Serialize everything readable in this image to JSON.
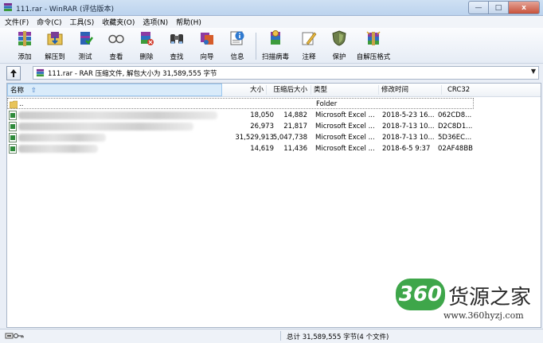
{
  "window": {
    "title": "111.rar - WinRAR (评估版本)",
    "min_label": "—",
    "max_label": "□",
    "close_label": "x"
  },
  "menu": [
    "文件(F)",
    "命令(C)",
    "工具(S)",
    "收藏夹(O)",
    "选项(N)",
    "帮助(H)"
  ],
  "toolbar": [
    {
      "label": "添加",
      "icon": "add-books-icon"
    },
    {
      "label": "解压到",
      "icon": "extract-folder-icon"
    },
    {
      "label": "测试",
      "icon": "test-icon"
    },
    {
      "label": "查看",
      "icon": "view-glasses-icon"
    },
    {
      "label": "删除",
      "icon": "delete-icon"
    },
    {
      "label": "查找",
      "icon": "find-binoculars-icon"
    },
    {
      "label": "向导",
      "icon": "wizard-icon"
    },
    {
      "label": "信息",
      "icon": "info-icon"
    },
    {
      "label": "扫描病毒",
      "icon": "virus-scan-icon"
    },
    {
      "label": "注释",
      "icon": "comment-icon"
    },
    {
      "label": "保护",
      "icon": "protect-shield-icon"
    },
    {
      "label": "自解压格式",
      "icon": "sfx-icon"
    }
  ],
  "address": {
    "text": "111.rar - RAR 压缩文件, 解包大小为 31,589,555 字节"
  },
  "columns": {
    "name": "名称",
    "size": "大小",
    "packed": "压缩后大小",
    "type": "类型",
    "modified": "修改时间",
    "crc": "CRC32"
  },
  "rows": [
    {
      "name": "..",
      "size": "",
      "packed": "",
      "type": "Folder",
      "modified": "",
      "crc": ""
    },
    {
      "name": "",
      "size": "18,050",
      "packed": "14,882",
      "type": "Microsoft Excel ...",
      "modified": "2018-5-23 16...",
      "crc": "062CD8..."
    },
    {
      "name": "",
      "size": "26,973",
      "packed": "21,817",
      "type": "Microsoft Excel ...",
      "modified": "2018-7-13 10...",
      "crc": "D2C8D1..."
    },
    {
      "name": "",
      "size": "31,529,913",
      "packed": "5,047,738",
      "type": "Microsoft Excel ...",
      "modified": "2018-7-13 10...",
      "crc": "5D36EC..."
    },
    {
      "name": "",
      "size": "14,619",
      "packed": "11,436",
      "type": "Microsoft Excel ...",
      "modified": "2018-6-5 9:37",
      "crc": "02AF48BB"
    }
  ],
  "status": {
    "text": "总计 31,589,555 字节(4 个文件)"
  },
  "watermark": {
    "logo": "360",
    "text": "货源之家",
    "url": "www.360hyzj.com"
  },
  "colors": {
    "accent": "#3ea64a",
    "header_highlight": "#d9ebfa"
  }
}
